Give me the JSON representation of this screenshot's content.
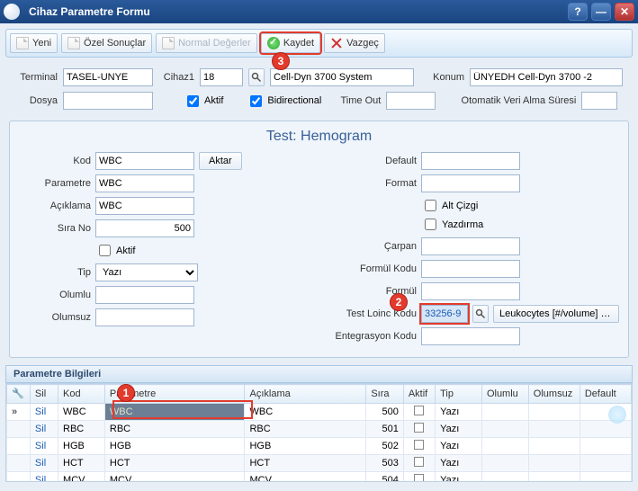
{
  "window": {
    "title": "Cihaz Parametre Formu"
  },
  "toolbar": {
    "yeni": "Yeni",
    "ozel": "Özel Sonuçlar",
    "normal": "Normal Değerler",
    "kaydet": "Kaydet",
    "vazgec": "Vazgeç"
  },
  "callouts": {
    "one": "1",
    "two": "2",
    "three": "3"
  },
  "header": {
    "terminal_lbl": "Terminal",
    "terminal_val": "TASEL-UNYE",
    "cihaz1_lbl": "Cihaz1",
    "cihaz1_val": "18",
    "cihaz_desc": "Cell-Dyn 3700 System",
    "konum_lbl": "Konum",
    "konum_val": "ÜNYEDH Cell-Dyn 3700 -2",
    "dosya_lbl": "Dosya",
    "dosya_val": "",
    "aktif_lbl": "Aktif",
    "bidi_lbl": "Bidirectional",
    "timeout_lbl": "Time Out",
    "timeout_val": "",
    "otomatik_lbl": "Otomatik Veri Alma Süresi",
    "otomatik_val": ""
  },
  "panel": {
    "title_pfx": "Test:  ",
    "title_name": "Hemogram",
    "left": {
      "kod_lbl": "Kod",
      "kod_val": "WBC",
      "param_lbl": "Parametre",
      "param_val": "WBC",
      "acik_lbl": "Açıklama",
      "acik_val": "WBC",
      "sira_lbl": "Sıra No",
      "sira_val": "500",
      "aktif_lbl": "Aktif",
      "tip_lbl": "Tip",
      "tip_val": "Yazı",
      "olumlu_lbl": "Olumlu",
      "olumlu_val": "",
      "olumsuz_lbl": "Olumsuz",
      "olumsuz_val": "",
      "aktar_btn": "Aktar"
    },
    "right": {
      "default_lbl": "Default",
      "default_val": "",
      "format_lbl": "Format",
      "format_val": "",
      "altcizgi_lbl": "Alt Çizgi",
      "yazdirma_lbl": "Yazdırma",
      "carpan_lbl": "Çarpan",
      "carpan_val": "",
      "formulkodu_lbl": "Formül Kodu",
      "formulkodu_val": "",
      "formul_lbl": "Formül",
      "formul_val": "",
      "loinc_lbl": "Test Loinc Kodu",
      "loinc_val": "33256-9",
      "loinc_desc": "Leukocytes [#/volume] corr...",
      "entegrasyon_lbl": "Entegrasyon Kodu",
      "entegrasyon_val": ""
    }
  },
  "grid": {
    "section_title": "Parametre Bilgileri",
    "cols": {
      "wrench": " ",
      "sil": "Sil",
      "kod": "Kod",
      "param": "Parametre",
      "acik": "Açıklama",
      "sira": "Sıra",
      "aktif": "Aktif",
      "tip": "Tip",
      "olumlu": "Olumlu",
      "olumsuz": "Olumsuz",
      "default": "Default"
    },
    "sil_link": "Sil",
    "rows": [
      {
        "kod": "WBC",
        "param": "WBC",
        "acik": "WBC",
        "sira": "500",
        "tip": "Yazı"
      },
      {
        "kod": "RBC",
        "param": "RBC",
        "acik": "RBC",
        "sira": "501",
        "tip": "Yazı"
      },
      {
        "kod": "HGB",
        "param": "HGB",
        "acik": "HGB",
        "sira": "502",
        "tip": "Yazı"
      },
      {
        "kod": "HCT",
        "param": "HCT",
        "acik": "HCT",
        "sira": "503",
        "tip": "Yazı"
      },
      {
        "kod": "MCV",
        "param": "MCV",
        "acik": "MCV",
        "sira": "504",
        "tip": "Yazı"
      }
    ]
  }
}
